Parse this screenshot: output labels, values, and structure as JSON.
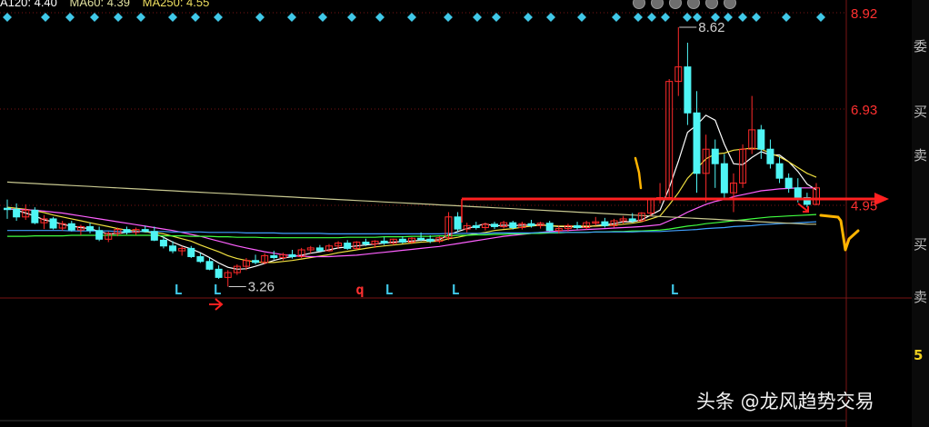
{
  "legend": {
    "items": [
      {
        "text": "A120: 4.40",
        "color": "#ffffff"
      },
      {
        "text": "MA60: 4.39",
        "color": "#e0e0a0"
      },
      {
        "text": "MA250: 4.55",
        "color": "#f0e060"
      }
    ]
  },
  "toolbar": {
    "icons": [
      "zoom-in-icon",
      "hand-icon",
      "play-icon",
      "flag-icon",
      "settings-icon",
      "close-icon"
    ]
  },
  "colors": {
    "up": "#ff2a2a",
    "down": "#4ff5f5",
    "grid": "#7a1515",
    "axis_text": "#ff3030",
    "ma5": "#ffffff",
    "ma10": "#f0e040",
    "ma20": "#ff60ff",
    "ma60": "#40ff40",
    "ma120": "#40a0ff",
    "ma250": "#c8c890",
    "diamond": "#40c8e8",
    "signal": "#40c8e8",
    "signal_q": "#ff3030",
    "annotation_red": "#ff2020",
    "annotation_orange": "#ffb400"
  },
  "chart_data": {
    "type": "candlestick",
    "y_ticks": [
      8.92,
      6.93,
      4.95
    ],
    "ylim": [
      2.0,
      9.3
    ],
    "grid": true,
    "annotations": [
      {
        "label": "8.62",
        "value": 8.62
      },
      {
        "label": "3.26",
        "value": 3.26
      }
    ],
    "signals": [
      "L",
      "L",
      "q",
      "L",
      "L",
      "L"
    ],
    "series": [
      {
        "name": "",
        "kind": "candles",
        "ohlc": [
          [
            4.88,
            5.06,
            4.66,
            4.86
          ],
          [
            4.86,
            4.98,
            4.62,
            4.7
          ],
          [
            4.7,
            4.96,
            4.64,
            4.84
          ],
          [
            4.84,
            4.9,
            4.55,
            4.58
          ],
          [
            4.58,
            4.74,
            4.45,
            4.66
          ],
          [
            4.66,
            4.7,
            4.44,
            4.47
          ],
          [
            4.47,
            4.62,
            4.42,
            4.56
          ],
          [
            4.56,
            4.62,
            4.4,
            4.43
          ],
          [
            4.43,
            4.54,
            4.32,
            4.5
          ],
          [
            4.5,
            4.58,
            4.36,
            4.42
          ],
          [
            4.42,
            4.5,
            4.2,
            4.24
          ],
          [
            4.24,
            4.4,
            4.18,
            4.36
          ],
          [
            4.36,
            4.48,
            4.3,
            4.44
          ],
          [
            4.44,
            4.5,
            4.34,
            4.38
          ],
          [
            4.38,
            4.48,
            4.32,
            4.44
          ],
          [
            4.44,
            4.52,
            4.38,
            4.4
          ],
          [
            4.4,
            4.5,
            4.2,
            4.22
          ],
          [
            4.22,
            4.28,
            4.05,
            4.1
          ],
          [
            4.1,
            4.2,
            3.95,
            4.0
          ],
          [
            4.0,
            4.1,
            3.9,
            4.05
          ],
          [
            4.05,
            4.1,
            3.85,
            3.88
          ],
          [
            3.88,
            3.95,
            3.75,
            3.78
          ],
          [
            3.78,
            3.85,
            3.6,
            3.62
          ],
          [
            3.62,
            3.7,
            3.42,
            3.45
          ],
          [
            3.45,
            3.6,
            3.26,
            3.55
          ],
          [
            3.55,
            3.72,
            3.5,
            3.68
          ],
          [
            3.68,
            3.85,
            3.6,
            3.8
          ],
          [
            3.8,
            3.92,
            3.72,
            3.76
          ],
          [
            3.76,
            3.95,
            3.72,
            3.9
          ],
          [
            3.9,
            4.0,
            3.82,
            3.86
          ],
          [
            3.86,
            3.96,
            3.8,
            3.92
          ],
          [
            3.92,
            4.02,
            3.84,
            3.88
          ],
          [
            3.88,
            4.06,
            3.85,
            4.02
          ],
          [
            4.02,
            4.1,
            3.95,
            4.06
          ],
          [
            4.06,
            4.12,
            3.98,
            4.0
          ],
          [
            4.0,
            4.14,
            3.98,
            4.1
          ],
          [
            4.1,
            4.2,
            4.04,
            4.16
          ],
          [
            4.16,
            4.22,
            4.02,
            4.05
          ],
          [
            4.05,
            4.2,
            4.02,
            4.18
          ],
          [
            4.18,
            4.25,
            4.1,
            4.14
          ],
          [
            4.14,
            4.22,
            4.06,
            4.2
          ],
          [
            4.2,
            4.28,
            4.12,
            4.16
          ],
          [
            4.16,
            4.25,
            4.12,
            4.24
          ],
          [
            4.24,
            4.3,
            4.15,
            4.18
          ],
          [
            4.18,
            4.28,
            4.14,
            4.26
          ],
          [
            4.26,
            4.38,
            4.2,
            4.24
          ],
          [
            4.24,
            4.32,
            4.16,
            4.2
          ],
          [
            4.2,
            4.3,
            4.16,
            4.27
          ],
          [
            4.27,
            4.8,
            4.22,
            4.7
          ],
          [
            4.7,
            4.8,
            4.4,
            4.45
          ],
          [
            4.45,
            4.58,
            4.38,
            4.52
          ],
          [
            4.52,
            4.6,
            4.44,
            4.48
          ],
          [
            4.48,
            4.58,
            4.42,
            4.55
          ],
          [
            4.55,
            4.6,
            4.45,
            4.5
          ],
          [
            4.5,
            4.62,
            4.46,
            4.58
          ],
          [
            4.58,
            4.62,
            4.44,
            4.48
          ],
          [
            4.48,
            4.6,
            4.44,
            4.56
          ],
          [
            4.56,
            4.64,
            4.48,
            4.52
          ],
          [
            4.52,
            4.6,
            4.46,
            4.57
          ],
          [
            4.57,
            4.62,
            4.4,
            4.42
          ],
          [
            4.42,
            4.52,
            4.36,
            4.46
          ],
          [
            4.46,
            4.56,
            4.4,
            4.52
          ],
          [
            4.52,
            4.6,
            4.44,
            4.48
          ],
          [
            4.48,
            4.62,
            4.44,
            4.58
          ],
          [
            4.58,
            4.7,
            4.52,
            4.6
          ],
          [
            4.6,
            4.68,
            4.48,
            4.52
          ],
          [
            4.52,
            4.66,
            4.48,
            4.62
          ],
          [
            4.62,
            4.72,
            4.56,
            4.66
          ],
          [
            4.66,
            4.78,
            4.58,
            4.62
          ],
          [
            4.62,
            4.8,
            4.6,
            4.78
          ],
          [
            4.78,
            5.1,
            4.72,
            5.06
          ],
          [
            5.06,
            5.4,
            4.98,
            5.1
          ],
          [
            5.1,
            7.55,
            5.05,
            7.5
          ],
          [
            7.5,
            8.62,
            7.2,
            7.8
          ],
          [
            7.8,
            8.3,
            6.6,
            6.85
          ],
          [
            6.85,
            7.3,
            5.2,
            5.6
          ],
          [
            5.6,
            6.4,
            5.0,
            6.1
          ],
          [
            6.1,
            6.3,
            5.3,
            5.8
          ],
          [
            5.8,
            6.0,
            5.1,
            5.2
          ],
          [
            5.2,
            5.6,
            4.8,
            5.4
          ],
          [
            5.4,
            6.2,
            5.3,
            6.1
          ],
          [
            6.1,
            7.2,
            6.0,
            6.5
          ],
          [
            6.5,
            6.6,
            5.9,
            6.1
          ],
          [
            6.1,
            6.3,
            5.7,
            5.8
          ],
          [
            5.8,
            5.95,
            5.4,
            5.5
          ],
          [
            5.5,
            5.6,
            5.2,
            5.3
          ],
          [
            5.3,
            5.5,
            5.0,
            5.1
          ],
          [
            5.1,
            5.2,
            4.9,
            4.96
          ],
          [
            4.96,
            5.4,
            4.94,
            5.3
          ]
        ]
      },
      {
        "name": "",
        "kind": "line",
        "color": "ma5",
        "values": [
          4.88,
          4.84,
          4.78,
          4.72,
          4.64,
          4.6,
          4.55,
          4.51,
          4.48,
          4.46,
          4.4,
          4.35,
          4.36,
          4.38,
          4.4,
          4.4,
          4.36,
          4.28,
          4.18,
          4.1,
          4.04,
          3.96,
          3.86,
          3.75,
          3.66,
          3.62,
          3.63,
          3.68,
          3.74,
          3.8,
          3.85,
          3.88,
          3.91,
          3.95,
          3.98,
          4.02,
          4.06,
          4.08,
          4.1,
          4.12,
          4.14,
          4.16,
          4.18,
          4.19,
          4.2,
          4.22,
          4.22,
          4.23,
          4.33,
          4.4,
          4.46,
          4.51,
          4.56,
          4.51,
          4.53,
          4.52,
          4.53,
          4.53,
          4.54,
          4.52,
          4.5,
          4.5,
          4.49,
          4.49,
          4.52,
          4.54,
          4.56,
          4.6,
          4.6,
          4.64,
          4.74,
          4.84,
          5.3,
          5.85,
          6.45,
          6.6,
          6.8,
          6.7,
          6.2,
          5.8,
          5.78,
          5.93,
          6.05,
          5.98,
          5.98,
          5.84,
          5.64,
          5.38,
          5.26
        ]
      },
      {
        "name": "",
        "kind": "line",
        "color": "ma10",
        "values": [
          4.9,
          4.88,
          4.86,
          4.83,
          4.79,
          4.74,
          4.7,
          4.66,
          4.62,
          4.58,
          4.54,
          4.5,
          4.46,
          4.43,
          4.41,
          4.39,
          4.38,
          4.35,
          4.3,
          4.25,
          4.2,
          4.12,
          4.05,
          3.98,
          3.9,
          3.84,
          3.8,
          3.77,
          3.76,
          3.76,
          3.78,
          3.8,
          3.83,
          3.86,
          3.89,
          3.92,
          3.96,
          3.99,
          4.02,
          4.05,
          4.08,
          4.1,
          4.12,
          4.14,
          4.16,
          4.18,
          4.19,
          4.2,
          4.25,
          4.28,
          4.32,
          4.35,
          4.38,
          4.42,
          4.44,
          4.46,
          4.49,
          4.51,
          4.53,
          4.52,
          4.51,
          4.51,
          4.51,
          4.51,
          4.51,
          4.52,
          4.53,
          4.55,
          4.57,
          4.6,
          4.66,
          4.72,
          4.95,
          5.2,
          5.5,
          5.7,
          5.9,
          6.0,
          6.02,
          6.08,
          6.1,
          6.12,
          6.1,
          6.02,
          5.94,
          5.84,
          5.72,
          5.6,
          5.52
        ]
      },
      {
        "name": "",
        "kind": "line",
        "color": "ma20",
        "values": [
          4.86,
          4.86,
          4.85,
          4.84,
          4.82,
          4.8,
          4.78,
          4.75,
          4.72,
          4.69,
          4.66,
          4.63,
          4.6,
          4.57,
          4.54,
          4.51,
          4.48,
          4.45,
          4.42,
          4.38,
          4.34,
          4.3,
          4.25,
          4.2,
          4.15,
          4.1,
          4.06,
          4.02,
          3.98,
          3.95,
          3.92,
          3.9,
          3.89,
          3.88,
          3.88,
          3.88,
          3.89,
          3.9,
          3.91,
          3.93,
          3.95,
          3.97,
          3.99,
          4.01,
          4.03,
          4.05,
          4.07,
          4.09,
          4.12,
          4.15,
          4.18,
          4.21,
          4.24,
          4.27,
          4.3,
          4.32,
          4.34,
          4.36,
          4.38,
          4.4,
          4.41,
          4.42,
          4.43,
          4.44,
          4.45,
          4.46,
          4.47,
          4.48,
          4.49,
          4.5,
          4.52,
          4.54,
          4.62,
          4.7,
          4.8,
          4.88,
          4.96,
          5.02,
          5.06,
          5.12,
          5.16,
          5.2,
          5.24,
          5.26,
          5.28,
          5.29,
          5.3,
          5.3,
          5.3
        ]
      },
      {
        "name": "",
        "kind": "line",
        "color": "ma60",
        "values": [
          4.3,
          4.3,
          4.3,
          4.31,
          4.31,
          4.31,
          4.31,
          4.32,
          4.32,
          4.32,
          4.32,
          4.32,
          4.32,
          4.32,
          4.32,
          4.32,
          4.32,
          4.31,
          4.31,
          4.31,
          4.3,
          4.3,
          4.3,
          4.29,
          4.29,
          4.28,
          4.28,
          4.28,
          4.27,
          4.27,
          4.27,
          4.27,
          4.27,
          4.27,
          4.27,
          4.27,
          4.27,
          4.28,
          4.28,
          4.28,
          4.28,
          4.29,
          4.29,
          4.29,
          4.3,
          4.3,
          4.3,
          4.31,
          4.31,
          4.32,
          4.32,
          4.33,
          4.33,
          4.34,
          4.34,
          4.35,
          4.35,
          4.36,
          4.36,
          4.37,
          4.37,
          4.38,
          4.38,
          4.38,
          4.39,
          4.39,
          4.4,
          4.4,
          4.41,
          4.41,
          4.42,
          4.43,
          4.45,
          4.48,
          4.51,
          4.53,
          4.56,
          4.58,
          4.6,
          4.62,
          4.64,
          4.66,
          4.68,
          4.7,
          4.71,
          4.72,
          4.73,
          4.74,
          4.75
        ]
      },
      {
        "name": "",
        "kind": "line",
        "color": "ma120",
        "values": [
          4.42,
          4.42,
          4.42,
          4.42,
          4.42,
          4.42,
          4.42,
          4.41,
          4.41,
          4.41,
          4.41,
          4.41,
          4.4,
          4.4,
          4.4,
          4.4,
          4.4,
          4.4,
          4.39,
          4.39,
          4.39,
          4.39,
          4.38,
          4.38,
          4.38,
          4.38,
          4.37,
          4.37,
          4.37,
          4.37,
          4.36,
          4.36,
          4.36,
          4.36,
          4.36,
          4.35,
          4.35,
          4.35,
          4.35,
          4.35,
          4.35,
          4.35,
          4.35,
          4.35,
          4.35,
          4.35,
          4.35,
          4.35,
          4.36,
          4.36,
          4.36,
          4.36,
          4.36,
          4.37,
          4.37,
          4.37,
          4.37,
          4.37,
          4.38,
          4.38,
          4.38,
          4.38,
          4.38,
          4.38,
          4.39,
          4.39,
          4.39,
          4.39,
          4.39,
          4.4,
          4.4,
          4.4,
          4.41,
          4.42,
          4.43,
          4.44,
          4.46,
          4.47,
          4.48,
          4.5,
          4.51,
          4.52,
          4.54,
          4.55,
          4.56,
          4.57,
          4.58,
          4.59,
          4.6
        ]
      },
      {
        "name": "",
        "kind": "line",
        "color": "ma250",
        "values": [
          5.42,
          5.41,
          5.4,
          5.39,
          5.38,
          5.37,
          5.36,
          5.35,
          5.34,
          5.33,
          5.32,
          5.31,
          5.3,
          5.29,
          5.28,
          5.27,
          5.26,
          5.25,
          5.24,
          5.23,
          5.22,
          5.21,
          5.2,
          5.19,
          5.18,
          5.17,
          5.16,
          5.15,
          5.14,
          5.13,
          5.12,
          5.11,
          5.1,
          5.09,
          5.08,
          5.07,
          5.06,
          5.05,
          5.04,
          5.03,
          5.02,
          5.01,
          5.0,
          4.99,
          4.98,
          4.97,
          4.96,
          4.95,
          4.94,
          4.93,
          4.92,
          4.91,
          4.9,
          4.89,
          4.88,
          4.87,
          4.86,
          4.85,
          4.84,
          4.83,
          4.82,
          4.81,
          4.8,
          4.79,
          4.78,
          4.77,
          4.76,
          4.75,
          4.74,
          4.73,
          4.72,
          4.71,
          4.7,
          4.69,
          4.68,
          4.67,
          4.66,
          4.65,
          4.64,
          4.63,
          4.62,
          4.61,
          4.6,
          4.59,
          4.58,
          4.57,
          4.56,
          4.55,
          4.55
        ]
      }
    ]
  },
  "right_panel": {
    "chars": [
      "委",
      "买",
      "卖",
      "买",
      "卖",
      "5"
    ]
  },
  "watermark": "头条 @龙风趋势交易"
}
